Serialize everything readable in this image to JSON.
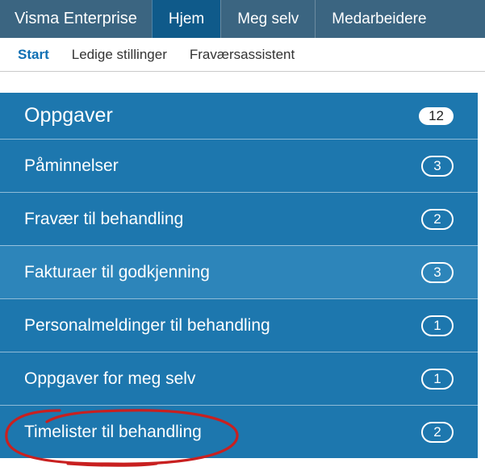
{
  "topnav": {
    "brand": "Visma Enterprise",
    "items": [
      {
        "label": "Hjem",
        "active": true
      },
      {
        "label": "Meg selv",
        "active": false
      },
      {
        "label": "Medarbeidere",
        "active": false
      }
    ]
  },
  "subnav": {
    "items": [
      {
        "label": "Start",
        "active": true
      },
      {
        "label": "Ledige stillinger",
        "active": false
      },
      {
        "label": "Fraværsassistent",
        "active": false
      }
    ]
  },
  "panel": {
    "title": "Oppgaver",
    "total": "12",
    "tasks": [
      {
        "label": "Påminnelser",
        "count": "3",
        "highlight": false
      },
      {
        "label": "Fravær til behandling",
        "count": "2",
        "highlight": false
      },
      {
        "label": "Fakturaer til godkjenning",
        "count": "3",
        "highlight": true
      },
      {
        "label": "Personalmeldinger til behandling",
        "count": "1",
        "highlight": false
      },
      {
        "label": "Oppgaver for meg selv",
        "count": "1",
        "highlight": false
      },
      {
        "label": "Timelister til behandling",
        "count": "2",
        "highlight": false
      }
    ]
  }
}
